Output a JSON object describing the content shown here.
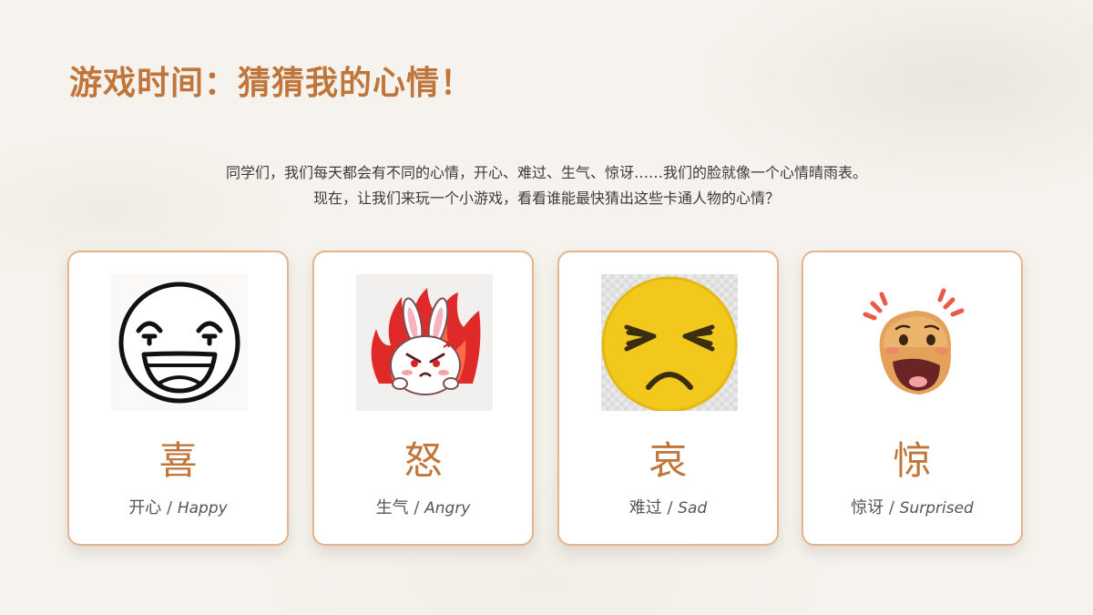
{
  "title": "游戏时间：猜猜我的心情！",
  "intro": {
    "line1": "同学们，我们每天都会有不同的心情，开心、难过、生气、惊讶……我们的脸就像一个心情晴雨表。",
    "line2": "现在，让我们来玩一个小游戏，看看谁能最快猜出这些卡通人物的心情？"
  },
  "cards": [
    {
      "icon": "happy-face-icon",
      "char": "喜",
      "cn": "开心",
      "sep": " / ",
      "en": "Happy"
    },
    {
      "icon": "angry-rabbit-icon",
      "char": "怒",
      "cn": "生气",
      "sep": " / ",
      "en": "Angry"
    },
    {
      "icon": "sad-face-icon",
      "char": "哀",
      "cn": "难过",
      "sep": " / ",
      "en": "Sad"
    },
    {
      "icon": "surprised-face-icon",
      "char": "惊",
      "cn": "惊讶",
      "sep": " / ",
      "en": "Surprised"
    }
  ],
  "colors": {
    "accent": "#c0763a",
    "card_border": "#e3b48d",
    "text": "#3b3b3b"
  }
}
